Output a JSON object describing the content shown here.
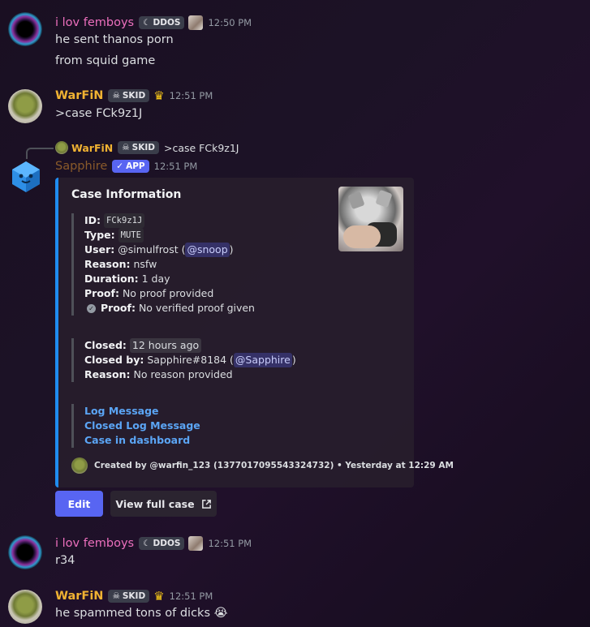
{
  "messages": [
    {
      "username": "i lov femboys",
      "tag": "DDOS",
      "time": "12:50 PM",
      "lines": [
        "he sent thanos porn",
        "from squid game"
      ]
    },
    {
      "username": "WarFiN",
      "tag": "SKID",
      "time": "12:51 PM",
      "lines": [
        ">case FCk9z1J"
      ]
    },
    {
      "reply": {
        "username": "WarFiN",
        "tag": "SKID",
        "text": ">case FCk9z1J"
      },
      "username": "Sapphire",
      "tag": "APP",
      "time": "12:51 PM"
    },
    {
      "username": "i lov femboys",
      "tag": "DDOS",
      "time": "12:51 PM",
      "lines": [
        "r34"
      ]
    },
    {
      "username": "WarFiN",
      "tag": "SKID",
      "time": "12:51 PM",
      "lines": [
        "he spammed tons of dicks 😭"
      ]
    }
  ],
  "embed": {
    "title": "Case Information",
    "fields": {
      "id_label": "ID:",
      "id_value": "FCk9z1J",
      "type_label": "Type:",
      "type_value": "MUTE",
      "user_label": "User:",
      "user_value": "@simulfrost (",
      "user_mention": "@snoop",
      "user_close": ")",
      "reason_label": "Reason:",
      "reason_value": "nsfw",
      "duration_label": "Duration:",
      "duration_value": "1 day",
      "proof_label": "Proof:",
      "proof_value": "No proof provided",
      "vproof_label": "Proof:",
      "vproof_value": "No verified proof given"
    },
    "closed": {
      "closed_label": "Closed:",
      "closed_value": "12 hours ago",
      "closedby_label": "Closed by:",
      "closedby_value": "Sapphire#8184 (",
      "closedby_mention": "@Sapphire",
      "closedby_close": ")",
      "reason_label": "Reason:",
      "reason_value": "No reason provided"
    },
    "links": [
      "Log Message",
      "Closed Log Message",
      "Case in dashboard"
    ],
    "footer": "Created by @warfin_123 (1377017095543324732) • Yesterday at 12:29 AM"
  },
  "buttons": {
    "edit": "Edit",
    "view_full_case": "View full case"
  },
  "colors": {
    "embed_accent": "#1f8cf0",
    "pink_name": "#ec6fbd",
    "gold_name": "#f0b232",
    "primary_button": "#5865f2"
  }
}
